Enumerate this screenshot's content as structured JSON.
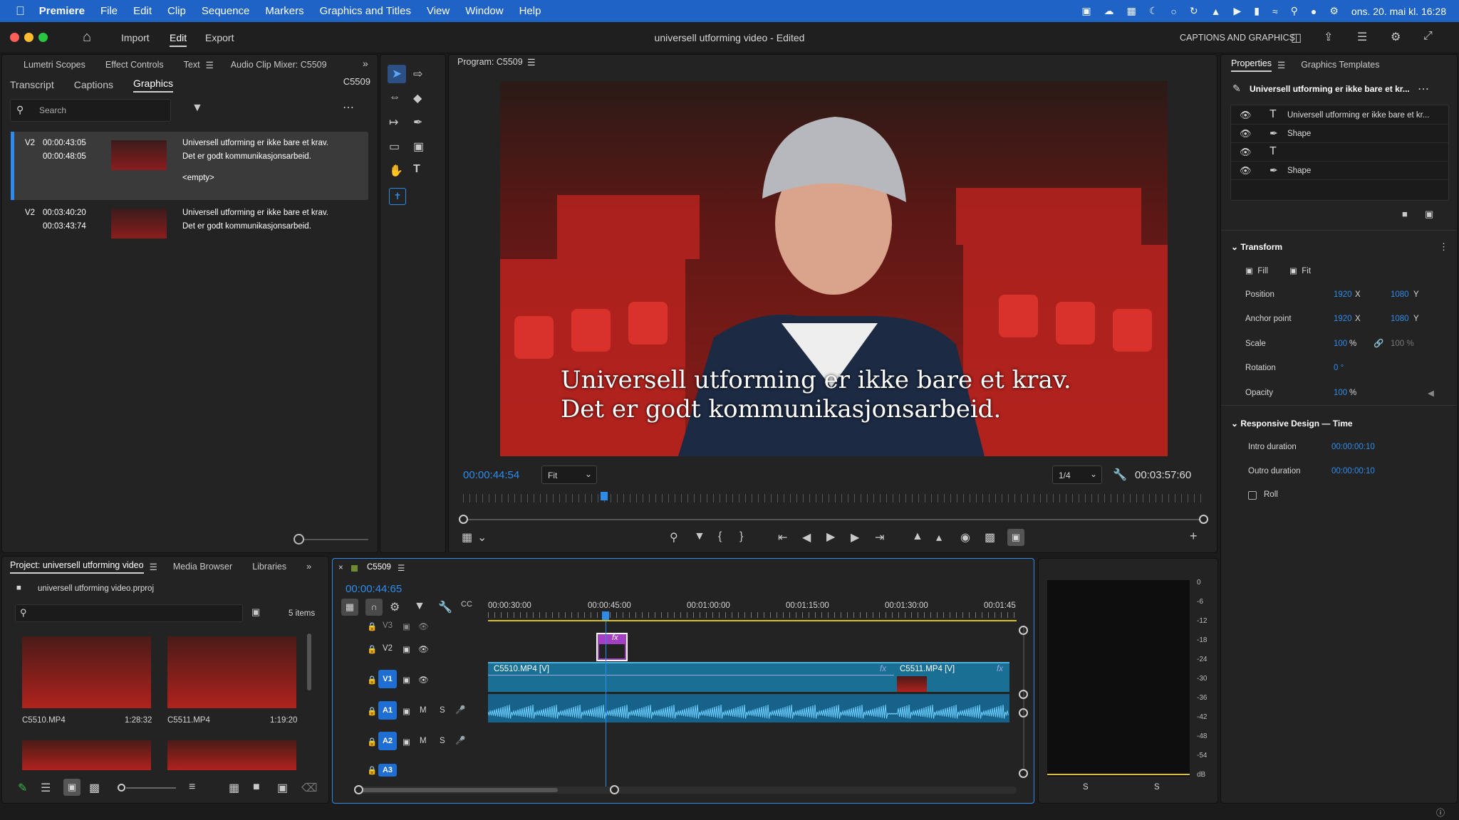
{
  "menubar": {
    "app_name": "Premiere",
    "items": [
      "File",
      "Edit",
      "Clip",
      "Sequence",
      "Markers",
      "Graphics and Titles",
      "View",
      "Window",
      "Help"
    ],
    "clock": "ons. 20. mai kl. 16:28"
  },
  "header": {
    "nav": [
      "Import",
      "Edit",
      "Export"
    ],
    "active_nav": "Edit",
    "title": "universell utforming video - Edited",
    "workspace": "CAPTIONS AND GRAPHICS"
  },
  "left_panel": {
    "tabs_row1": [
      "Lumetri Scopes",
      "Effect Controls",
      "Text",
      "Audio Clip Mixer: C5509"
    ],
    "tabs_row2": [
      "Transcript",
      "Captions",
      "Graphics"
    ],
    "active_tab": "Graphics",
    "sequence": "C5509",
    "search_placeholder": "Search",
    "items": [
      {
        "track": "V2",
        "in": "00:00:43:05",
        "out": "00:00:48:05",
        "line1": "Universell utforming er ikke bare et krav.",
        "line2": "Det er godt kommunikasjonsarbeid.",
        "extra": "<empty>"
      },
      {
        "track": "V2",
        "in": "00:03:40:20",
        "out": "00:03:43:74",
        "line1": "Universell utforming er ikke bare et krav.",
        "line2": "Det er godt kommunikasjonsarbeid.",
        "extra": ""
      }
    ]
  },
  "program": {
    "title": "Program: C5509",
    "caption_line1": "Universell utforming er ikke bare et krav.",
    "caption_line2": "Det er godt kommunikasjonsarbeid.",
    "current_time": "00:00:44:54",
    "fit": "Fit",
    "resolution": "1/4",
    "duration": "00:03:57:60",
    "playhead_fraction": 0.19
  },
  "properties": {
    "tabs": [
      "Properties",
      "Graphics Templates"
    ],
    "layer_title": "Universell utforming er ikke bare et kr...",
    "layers": [
      {
        "icon": "text-icon",
        "name": "Universell utforming er ikke bare et kr..."
      },
      {
        "icon": "pen-icon",
        "name": "Shape"
      },
      {
        "icon": "text-icon",
        "name": ""
      },
      {
        "icon": "pen-icon",
        "name": "Shape"
      }
    ],
    "transform": {
      "header": "Transform",
      "fill": "Fill",
      "fit": "Fit",
      "position": {
        "label": "Position",
        "x": "1920",
        "y": "1080"
      },
      "anchor": {
        "label": "Anchor point",
        "x": "1920",
        "y": "1080"
      },
      "scale": {
        "label": "Scale",
        "value": "100",
        "unit": "%",
        "alt": "100 %"
      },
      "rotation": {
        "label": "Rotation",
        "value": "0 °"
      },
      "opacity": {
        "label": "Opacity",
        "value": "100",
        "unit": "%"
      }
    },
    "responsive": {
      "header": "Responsive Design — Time",
      "intro_label": "Intro duration",
      "intro": "00:00:00:10",
      "outro_label": "Outro duration",
      "outro": "00:00:00:10",
      "roll": "Roll"
    }
  },
  "project": {
    "tabs": [
      "Project: universell utforming video",
      "Media Browser",
      "Libraries"
    ],
    "file": "universell utforming video.prproj",
    "count": "5 items",
    "clips": [
      {
        "name": "C5510.MP4",
        "duration": "1:28:32"
      },
      {
        "name": "C5511.MP4",
        "duration": "1:19:20"
      }
    ]
  },
  "timeline": {
    "sequence": "C5509",
    "timecode": "00:00:44:65",
    "ruler": [
      "00:00:30:00",
      "00:00:45:00",
      "00:01:00:00",
      "00:01:15:00",
      "00:01:30:00",
      "00:01:45"
    ],
    "tracks": [
      {
        "id": "V3"
      },
      {
        "id": "V2"
      },
      {
        "id": "V1"
      },
      {
        "id": "A1"
      },
      {
        "id": "A2"
      },
      {
        "id": "A3"
      }
    ],
    "clip1": "C5510.MP4 [V]",
    "clip2": "C5511.MP4 [V]",
    "fx": "fx",
    "mute": "M",
    "solo": "S"
  },
  "meter": {
    "scale": [
      "0",
      "-6",
      "-12",
      "-18",
      "-24",
      "-30",
      "-36",
      "-42",
      "-48",
      "-54",
      "dB"
    ],
    "channels": [
      "S",
      "S"
    ]
  },
  "colors": {
    "accent": "#2d8ceb",
    "menubar": "#1e63c5",
    "clip_video": "#1a6f95",
    "graphic": "#a23fc2"
  }
}
